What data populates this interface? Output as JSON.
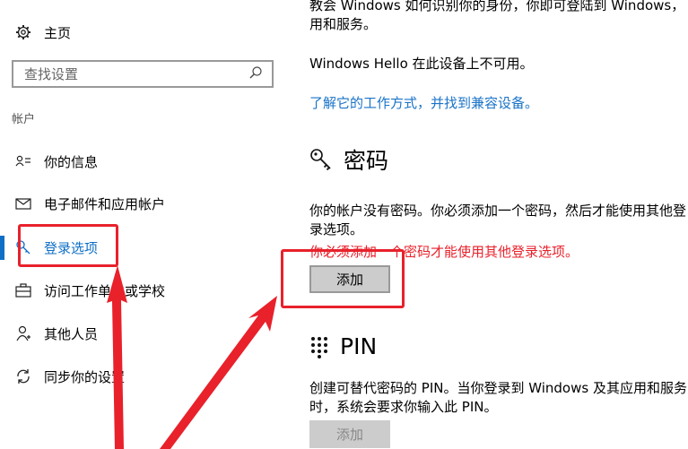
{
  "sidebar": {
    "home_label": "主页",
    "search_placeholder": "查找设置",
    "section_label": "帐户",
    "items": [
      {
        "label": "你的信息",
        "icon": "person-card-icon"
      },
      {
        "label": "电子邮件和应用帐户",
        "icon": "mail-icon"
      },
      {
        "label": "登录选项",
        "icon": "key-icon",
        "active": true
      },
      {
        "label": "访问工作单位或学校",
        "icon": "briefcase-icon"
      },
      {
        "label": "其他人员",
        "icon": "person-icon"
      },
      {
        "label": "同步你的设置",
        "icon": "sync-icon"
      }
    ]
  },
  "main": {
    "intro_text": "教会 Windows 如何识别你的身份，你即可登陆到 Windows，用和服务。",
    "hello_text": "Windows Hello 在此设备上不可用。",
    "hello_link": "了解它的工作方式，并找到兼容设备。",
    "password": {
      "heading": "密码",
      "description": "你的帐户没有密码。你必须添加一个密码，然后才能使用其他登录选项。",
      "warning": "你必须添加一个密码才能使用其他登录选项。",
      "add_button": "添加"
    },
    "pin": {
      "heading": "PIN",
      "description": "创建可替代密码的 PIN。当你登录到 Windows 及其应用和服务时，系统会要求你输入此 PIN。",
      "add_button": "添加"
    }
  },
  "colors": {
    "accent": "#0f6fc6",
    "link": "#1a73c8",
    "warning": "#e8212b",
    "annotation": "#e8212b"
  }
}
